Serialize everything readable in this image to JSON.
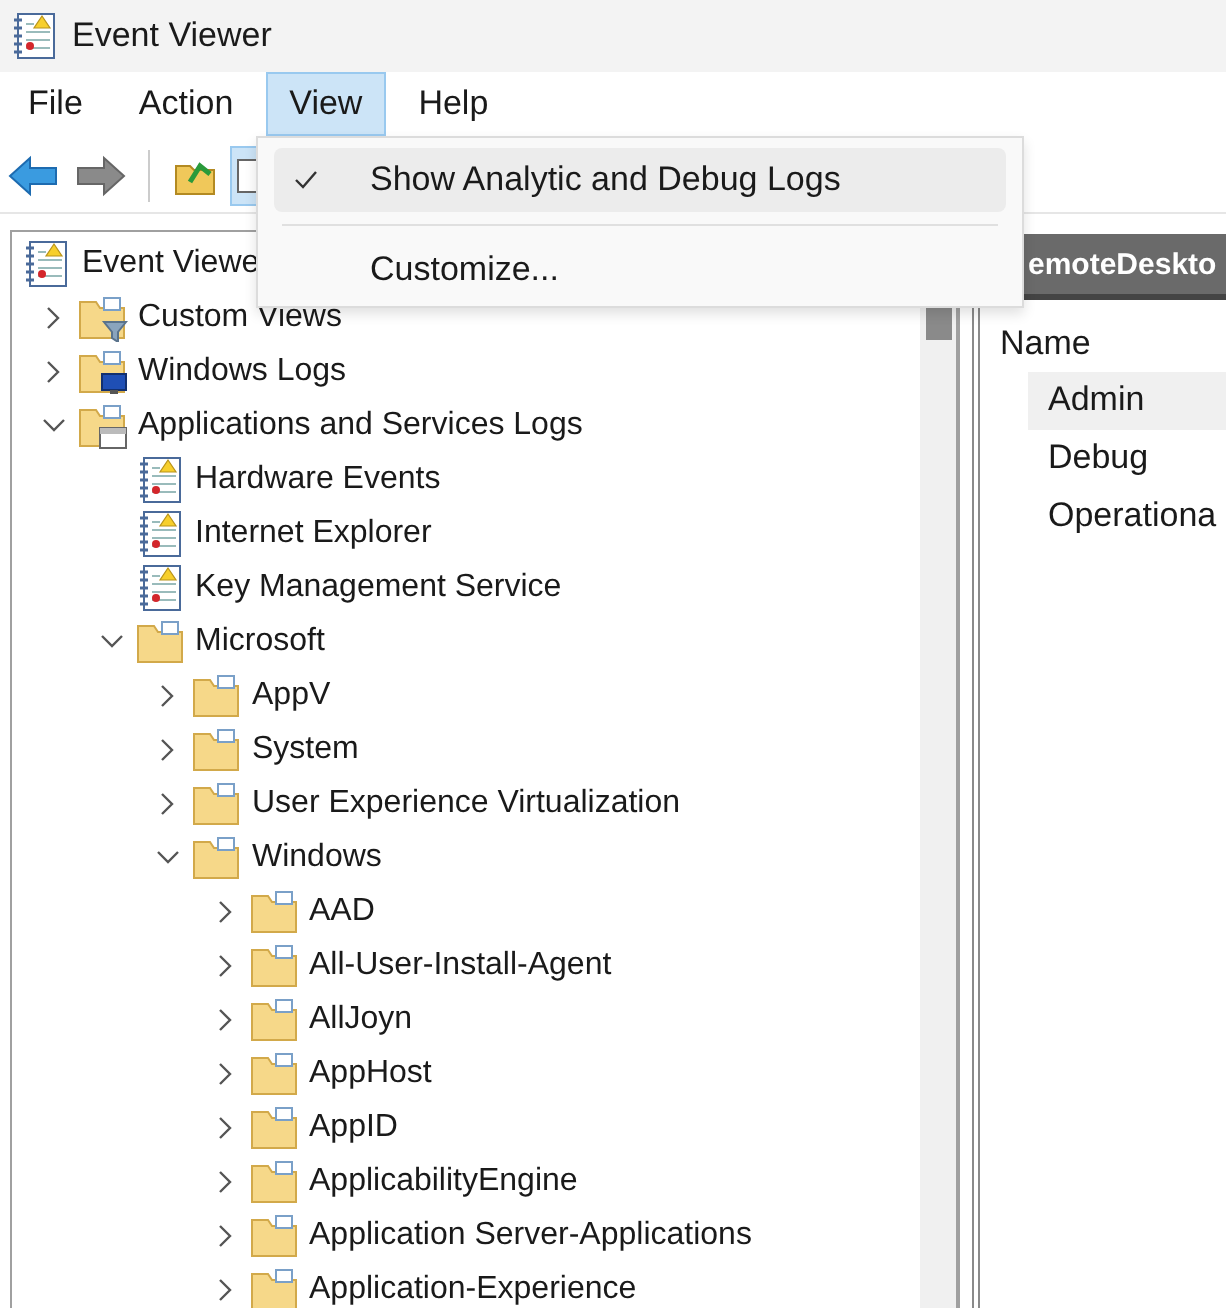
{
  "window": {
    "title": "Event Viewer"
  },
  "menu_bar": [
    {
      "label": "File",
      "selected": false
    },
    {
      "label": "Action",
      "selected": false
    },
    {
      "label": "View",
      "selected": true
    },
    {
      "label": "Help",
      "selected": false
    }
  ],
  "view_menu": {
    "items": [
      {
        "kind": "item",
        "label": "Show Analytic and Debug Logs",
        "checked": true,
        "highlighted": true
      },
      {
        "kind": "separator"
      },
      {
        "kind": "item",
        "label": "Customize...",
        "checked": false,
        "highlighted": false
      }
    ]
  },
  "toolbar": [
    {
      "kind": "back",
      "pressed": false
    },
    {
      "kind": "forward",
      "pressed": false
    },
    {
      "kind": "separator"
    },
    {
      "kind": "up",
      "pressed": false
    },
    {
      "kind": "properties",
      "pressed": true
    }
  ],
  "tree": {
    "label": "Event Viewe",
    "kind": "root",
    "children": [
      {
        "label": "Custom Views",
        "kind": "view-folder",
        "expanded": false
      },
      {
        "label": "Windows Logs",
        "kind": "logs-folder",
        "expanded": false
      },
      {
        "label": "Applications and Services Logs",
        "kind": "services-folder",
        "expanded": true,
        "children": [
          {
            "label": "Hardware Events",
            "kind": "log"
          },
          {
            "label": "Internet Explorer",
            "kind": "log"
          },
          {
            "label": "Key Management Service",
            "kind": "log"
          },
          {
            "label": "Microsoft",
            "kind": "folder",
            "expanded": true,
            "children": [
              {
                "label": "AppV",
                "kind": "folder",
                "expanded": false
              },
              {
                "label": "System",
                "kind": "folder",
                "expanded": false
              },
              {
                "label": "User Experience Virtualization",
                "kind": "folder",
                "expanded": false
              },
              {
                "label": "Windows",
                "kind": "folder",
                "expanded": true,
                "children": [
                  {
                    "label": "AAD",
                    "kind": "folder",
                    "expanded": false
                  },
                  {
                    "label": "All-User-Install-Agent",
                    "kind": "folder",
                    "expanded": false
                  },
                  {
                    "label": "AllJoyn",
                    "kind": "folder",
                    "expanded": false
                  },
                  {
                    "label": "AppHost",
                    "kind": "folder",
                    "expanded": false
                  },
                  {
                    "label": "AppID",
                    "kind": "folder",
                    "expanded": false
                  },
                  {
                    "label": "ApplicabilityEngine",
                    "kind": "folder",
                    "expanded": false
                  },
                  {
                    "label": "Application Server-Applications",
                    "kind": "folder",
                    "expanded": false
                  },
                  {
                    "label": "Application-Experience",
                    "kind": "folder",
                    "expanded": false
                  }
                ]
              }
            ]
          }
        ]
      }
    ]
  },
  "details_pane": {
    "header": "emoteDeskto",
    "column": "Name",
    "rows": [
      {
        "name": "Admin",
        "selected": true
      },
      {
        "name": "Debug",
        "selected": false
      },
      {
        "name": "Operationa",
        "selected": false
      }
    ]
  }
}
